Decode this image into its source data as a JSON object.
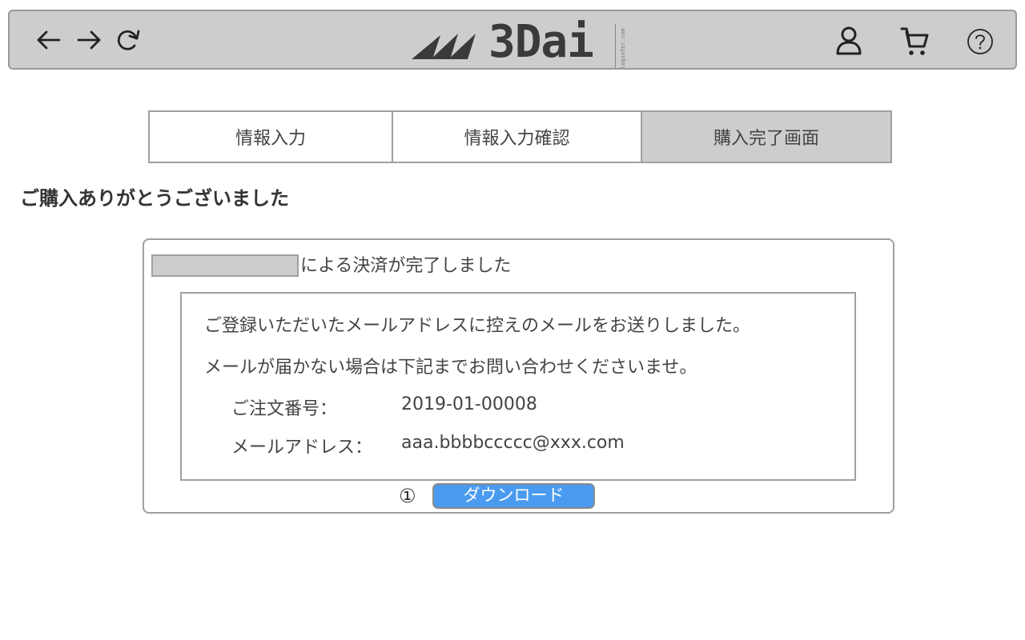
{
  "header": {
    "logo_text": "3Dai",
    "logo_subtext": "logsafer.com",
    "icons": {
      "back": "arrow-left-icon",
      "forward": "arrow-right-icon",
      "reload": "reload-icon",
      "user": "user-icon",
      "cart": "cart-icon",
      "help": "help-icon"
    }
  },
  "steps": [
    {
      "label": "情報入力",
      "active": false
    },
    {
      "label": "情報入力確認",
      "active": false
    },
    {
      "label": "購入完了画面",
      "active": true
    }
  ],
  "page_title": "ご購入ありがとうございました",
  "panel": {
    "payment_complete_text": "による決済が完了しました",
    "message_1": "ご登録いただいたメールアドレスに控えのメールをお送りしました。",
    "message_2": "メールが届かない場合は下記までお問い合わせくださいませ。",
    "order_number_label": "ご注文番号：",
    "order_number": "2019-01-00008",
    "email_label": "メールアドレス：",
    "email": "aaa.bbbbccccc@xxx.com",
    "download_marker": "①",
    "download_label": "ダウンロード"
  },
  "colors": {
    "header_bg": "#cdcdcd",
    "active_step_bg": "#cdcdcd",
    "border": "#a0a0a0",
    "download_button": "#4a9bf0"
  }
}
